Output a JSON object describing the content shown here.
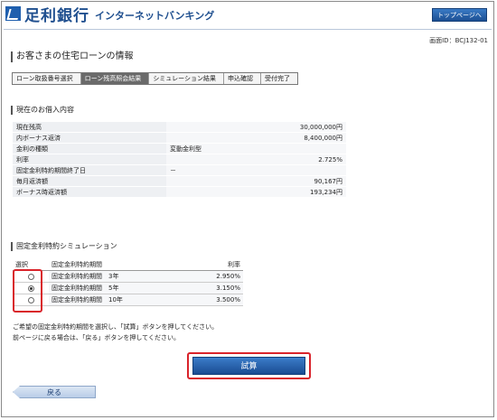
{
  "header": {
    "bank_name": "足利銀行",
    "service_name": "インターネットバンキング",
    "top_button": "トップページへ",
    "screen_id": "画面ID：BCJ132-01"
  },
  "page_title": "お客さまの住宅ローンの情報",
  "steps": [
    "ローン取扱番号選択",
    "ローン残高照会結果",
    "シミュレーション結果",
    "申込確認",
    "受付完了"
  ],
  "current_loan": {
    "section_title": "現在のお借入内容",
    "rows": [
      {
        "label": "現在残高",
        "value": "30,000,000円"
      },
      {
        "label": "内ボーナス返済",
        "value": "8,400,000円"
      },
      {
        "label": "金利の種類",
        "value": "変動金利型"
      },
      {
        "label": "利率",
        "value": "2.725%"
      },
      {
        "label": "固定金利特約期間終了日",
        "value": "－"
      },
      {
        "label": "毎月返済額",
        "value": "90,167円"
      },
      {
        "label": "ボーナス時返済額",
        "value": "193,234円"
      }
    ]
  },
  "simulation": {
    "section_title": "固定金利特約シミュレーション",
    "headers": {
      "select": "選択",
      "period": "固定金利特約期間",
      "rate": "利率"
    },
    "rows": [
      {
        "period": "固定金利特約期間　3年",
        "rate": "2.950%",
        "selected": false
      },
      {
        "period": "固定金利特約期間　5年",
        "rate": "3.150%",
        "selected": true
      },
      {
        "period": "固定金利特約期間　10年",
        "rate": "3.500%",
        "selected": false
      }
    ]
  },
  "notes": {
    "line1": "ご希望の固定金利特約期間を選択し、「試算」ボタンを押してください。",
    "line2": "前ページに戻る場合は、「戻る」ボタンを押してください。"
  },
  "buttons": {
    "calc": "試算",
    "back": "戻る"
  }
}
